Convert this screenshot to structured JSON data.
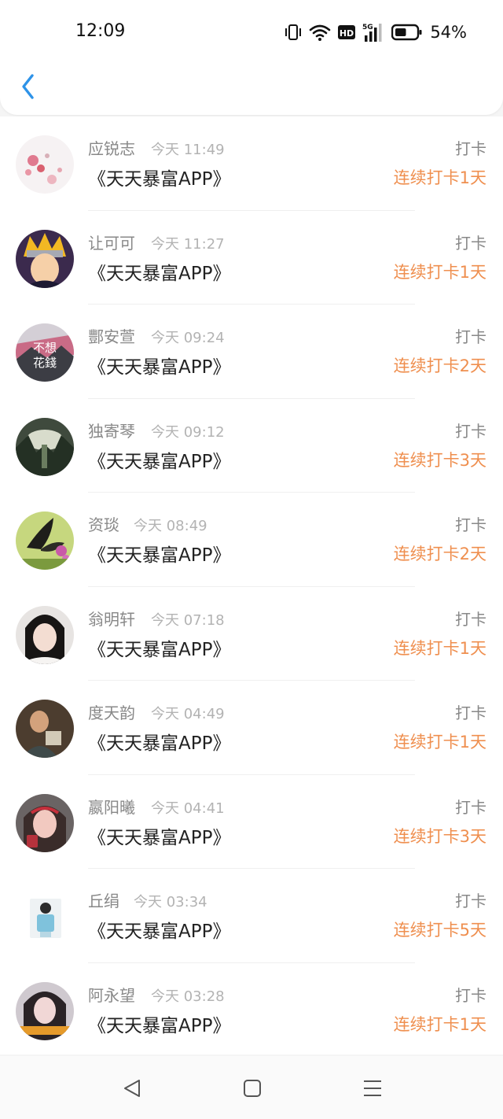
{
  "status_bar": {
    "time": "12:09",
    "battery_percent": "54%",
    "battery_level": 0.54,
    "icons": [
      "vibrate-icon",
      "wifi-icon",
      "hd-icon",
      "signal-5g-icon",
      "battery-icon"
    ]
  },
  "header": {
    "back_icon": "chevron-left-icon",
    "accent_color": "#2e93e8"
  },
  "colors": {
    "streak": "#ef8f4f",
    "name": "#888888",
    "time": "#b3b3b3"
  },
  "entries": [
    {
      "name": "应锐志",
      "time": "今天 11:49",
      "app": "《天天暴富APP》",
      "action": "打卡",
      "streak": "连续打卡1天"
    },
    {
      "name": "让可可",
      "time": "今天 11:27",
      "app": "《天天暴富APP》",
      "action": "打卡",
      "streak": "连续打卡1天"
    },
    {
      "name": "酆安萱",
      "time": "今天 09:24",
      "app": "《天天暴富APP》",
      "action": "打卡",
      "streak": "连续打卡2天",
      "avatar_text": [
        "不想",
        "花錢"
      ]
    },
    {
      "name": "独寄琴",
      "time": "今天 09:12",
      "app": "《天天暴富APP》",
      "action": "打卡",
      "streak": "连续打卡3天"
    },
    {
      "name": "资琰",
      "time": "今天 08:49",
      "app": "《天天暴富APP》",
      "action": "打卡",
      "streak": "连续打卡2天"
    },
    {
      "name": "翁明轩",
      "time": "今天 07:18",
      "app": "《天天暴富APP》",
      "action": "打卡",
      "streak": "连续打卡1天"
    },
    {
      "name": "度天韵",
      "time": "今天 04:49",
      "app": "《天天暴富APP》",
      "action": "打卡",
      "streak": "连续打卡1天"
    },
    {
      "name": "嬴阳曦",
      "time": "今天 04:41",
      "app": "《天天暴富APP》",
      "action": "打卡",
      "streak": "连续打卡3天"
    },
    {
      "name": "丘绢",
      "time": "今天 03:34",
      "app": "《天天暴富APP》",
      "action": "打卡",
      "streak": "连续打卡5天"
    },
    {
      "name": "阿永望",
      "time": "今天 03:28",
      "app": "《天天暴富APP》",
      "action": "打卡",
      "streak": "连续打卡1天"
    }
  ],
  "nav_bar": {
    "icons": [
      "back-triangle-icon",
      "home-square-icon",
      "menu-lines-icon"
    ]
  }
}
